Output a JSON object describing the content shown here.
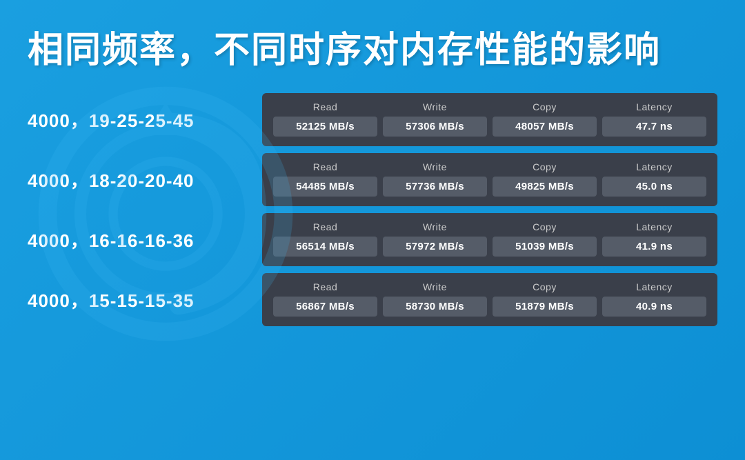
{
  "title": "相同频率，不同时序对内存性能的影响",
  "rows": [
    {
      "label": "4000，19-25-25-45",
      "read": "52125 MB/s",
      "write": "57306 MB/s",
      "copy": "48057 MB/s",
      "latency": "47.7 ns"
    },
    {
      "label": "4000，18-20-20-40",
      "read": "54485 MB/s",
      "write": "57736 MB/s",
      "copy": "49825 MB/s",
      "latency": "45.0 ns"
    },
    {
      "label": "4000，16-16-16-36",
      "read": "56514 MB/s",
      "write": "57972 MB/s",
      "copy": "51039 MB/s",
      "latency": "41.9 ns"
    },
    {
      "label": "4000，15-15-15-35",
      "read": "56867 MB/s",
      "write": "58730 MB/s",
      "copy": "51879 MB/s",
      "latency": "40.9 ns"
    }
  ],
  "column_headers": {
    "read": "Read",
    "write": "Write",
    "copy": "Copy",
    "latency": "Latency"
  }
}
